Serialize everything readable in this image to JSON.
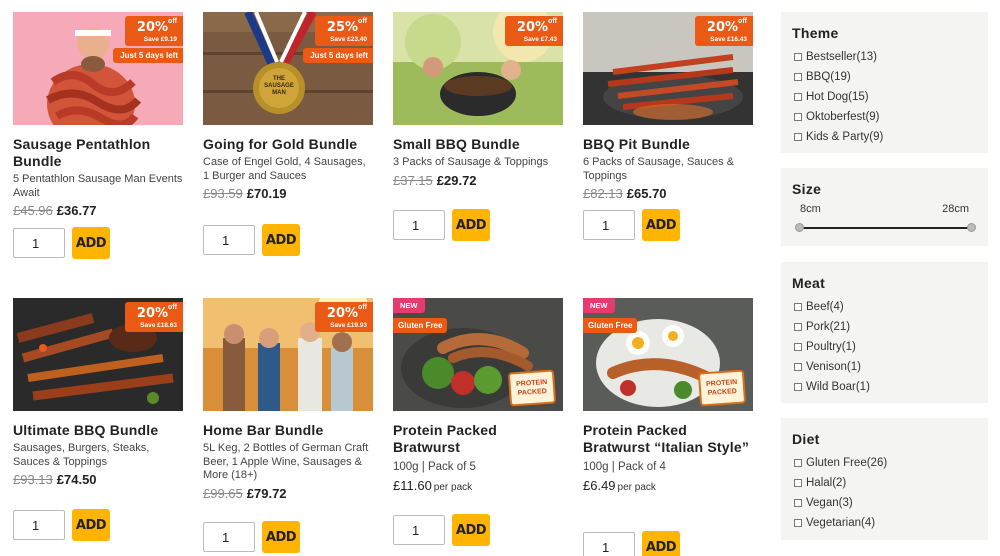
{
  "products": [
    {
      "title": "Sausage Pentathlon Bundle",
      "desc": "5 Pentathlon Sausage Man Events Await",
      "old_price": "£45.96",
      "price": "£36.77",
      "qty": "1",
      "add": "ADD",
      "badge": {
        "pct": "20%",
        "off": "off",
        "save": "Save £9.19"
      },
      "badge2": "Just 5 days left"
    },
    {
      "title": "Going for Gold Bundle",
      "desc": "Case of Engel Gold, 4 Sausages, 1 Burger and Sauces",
      "old_price": "£93.59",
      "price": "£70.19",
      "qty": "1",
      "add": "ADD",
      "badge": {
        "pct": "25%",
        "off": "off",
        "save": "Save £23.40"
      },
      "badge2": "Just 5 days left",
      "medal_text": "THE SAUSAGE MAN"
    },
    {
      "title": "Small BBQ Bundle",
      "desc": "3 Packs of Sausage & Toppings",
      "old_price": "£37.15",
      "price": "£29.72",
      "qty": "1",
      "add": "ADD",
      "badge": {
        "pct": "20%",
        "off": "off",
        "save": "Save £7.43"
      }
    },
    {
      "title": "BBQ Pit Bundle",
      "desc": "6 Packs of Sausage, Sauces & Toppings",
      "old_price": "£82.13",
      "price": "£65.70",
      "qty": "1",
      "add": "ADD",
      "badge": {
        "pct": "20%",
        "off": "off",
        "save": "Save £16.43"
      }
    },
    {
      "title": "Ultimate BBQ Bundle",
      "desc": "Sausages, Burgers, Steaks, Sauces & Toppings",
      "old_price": "£93.13",
      "price": "£74.50",
      "qty": "1",
      "add": "ADD",
      "badge": {
        "pct": "20%",
        "off": "off",
        "save": "Save £18.63"
      }
    },
    {
      "title": "Home Bar Bundle",
      "desc": "5L Keg, 2 Bottles of German Craft Beer, 1 Apple Wine, Sausages & More (18+)",
      "old_price": "£99.65",
      "price": "£79.72",
      "qty": "1",
      "add": "ADD",
      "badge": {
        "pct": "20%",
        "off": "off",
        "save": "Save £19.93"
      }
    },
    {
      "title": "Protein Packed Bratwurst",
      "desc": "100g | Pack of 5",
      "price": "£11.60",
      "per": "per pack",
      "qty": "1",
      "add": "ADD",
      "tag_new": "NEW",
      "tag_gf": "Gluten Free",
      "logo": "PROTEIN PACKED"
    },
    {
      "title": "Protein Packed Bratwurst “Italian Style”",
      "desc": "100g | Pack of 4",
      "price": "£6.49",
      "per": "per pack",
      "qty": "1",
      "add": "ADD",
      "tag_new": "NEW",
      "tag_gf": "Gluten Free",
      "logo": "PROTEIN PACKED"
    }
  ],
  "filters": {
    "theme": {
      "title": "Theme",
      "options": [
        "Bestseller(13)",
        "BBQ(19)",
        "Hot Dog(15)",
        "Oktoberfest(9)",
        "Kids & Party(9)"
      ]
    },
    "size": {
      "title": "Size",
      "min": "8cm",
      "max": "28cm",
      "range_low": 0,
      "range_high": 1
    },
    "meat": {
      "title": "Meat",
      "options": [
        "Beef(4)",
        "Pork(21)",
        "Poultry(1)",
        "Venison(1)",
        "Wild Boar(1)"
      ]
    },
    "diet": {
      "title": "Diet",
      "options": [
        "Gluten Free(26)",
        "Halal(2)",
        "Vegan(3)",
        "Vegetarian(4)"
      ]
    }
  },
  "colors": {
    "accent": "#ffb400",
    "badge": "#ea5a14",
    "new": "#e73a6e"
  }
}
